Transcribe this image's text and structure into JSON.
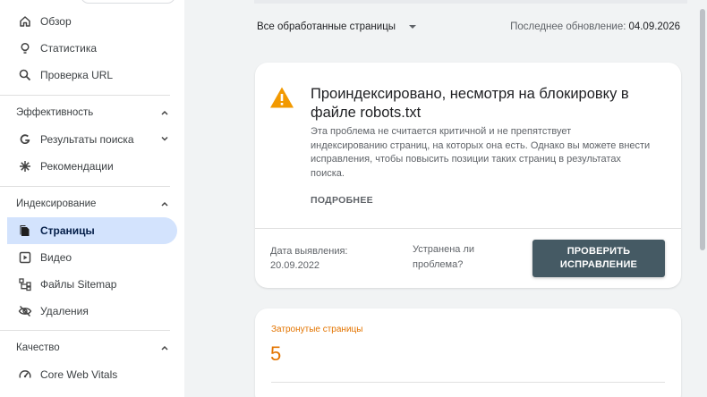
{
  "sidebar": {
    "items_top": [
      {
        "label": "Обзор",
        "icon": "home-icon"
      },
      {
        "label": "Статистика",
        "icon": "lightbulb-icon"
      },
      {
        "label": "Проверка URL",
        "icon": "search-icon"
      }
    ],
    "sections": [
      {
        "title": "Эффективность",
        "items": [
          {
            "label": "Результаты поиска",
            "icon": "google-g-icon"
          },
          {
            "label": "Рекомендации",
            "icon": "sparkle-icon"
          }
        ]
      },
      {
        "title": "Индексирование",
        "items": [
          {
            "label": "Страницы",
            "icon": "pages-icon",
            "active": true
          },
          {
            "label": "Видео",
            "icon": "video-icon"
          },
          {
            "label": "Файлы Sitemap",
            "icon": "sitemap-icon"
          },
          {
            "label": "Удаления",
            "icon": "eye-off-icon"
          }
        ]
      },
      {
        "title": "Качество",
        "items": [
          {
            "label": "Core Web Vitals",
            "icon": "gauge-icon"
          }
        ]
      }
    ]
  },
  "header": {
    "filter_label": "Все обработанные страницы",
    "last_update_label": "Последнее обновление:",
    "last_update_date": "04.09.2026"
  },
  "issue": {
    "title": "Проиндексировано, несмотря на блокировку в файле robots.txt",
    "description": "Эта проблема не считается критичной и не препятствует индексированию страниц, на которых она есть. Однако вы можете внести исправления, чтобы повысить позиции таких страниц в результатах поиска.",
    "more_label": "ПОДРОБНЕЕ",
    "detected_label": "Дата выявления: 20.09.2022",
    "fixed_question": "Устранена ли проблема?",
    "validate_label": "ПРОВЕРИТЬ ИСПРАВЛЕНИЕ"
  },
  "affected": {
    "label": "Затронутые страницы",
    "count": "5"
  },
  "colors": {
    "active_bg": "#d3e3fd",
    "warning": "#f29900",
    "accent_orange": "#e37400",
    "button_bg": "#455a64"
  }
}
